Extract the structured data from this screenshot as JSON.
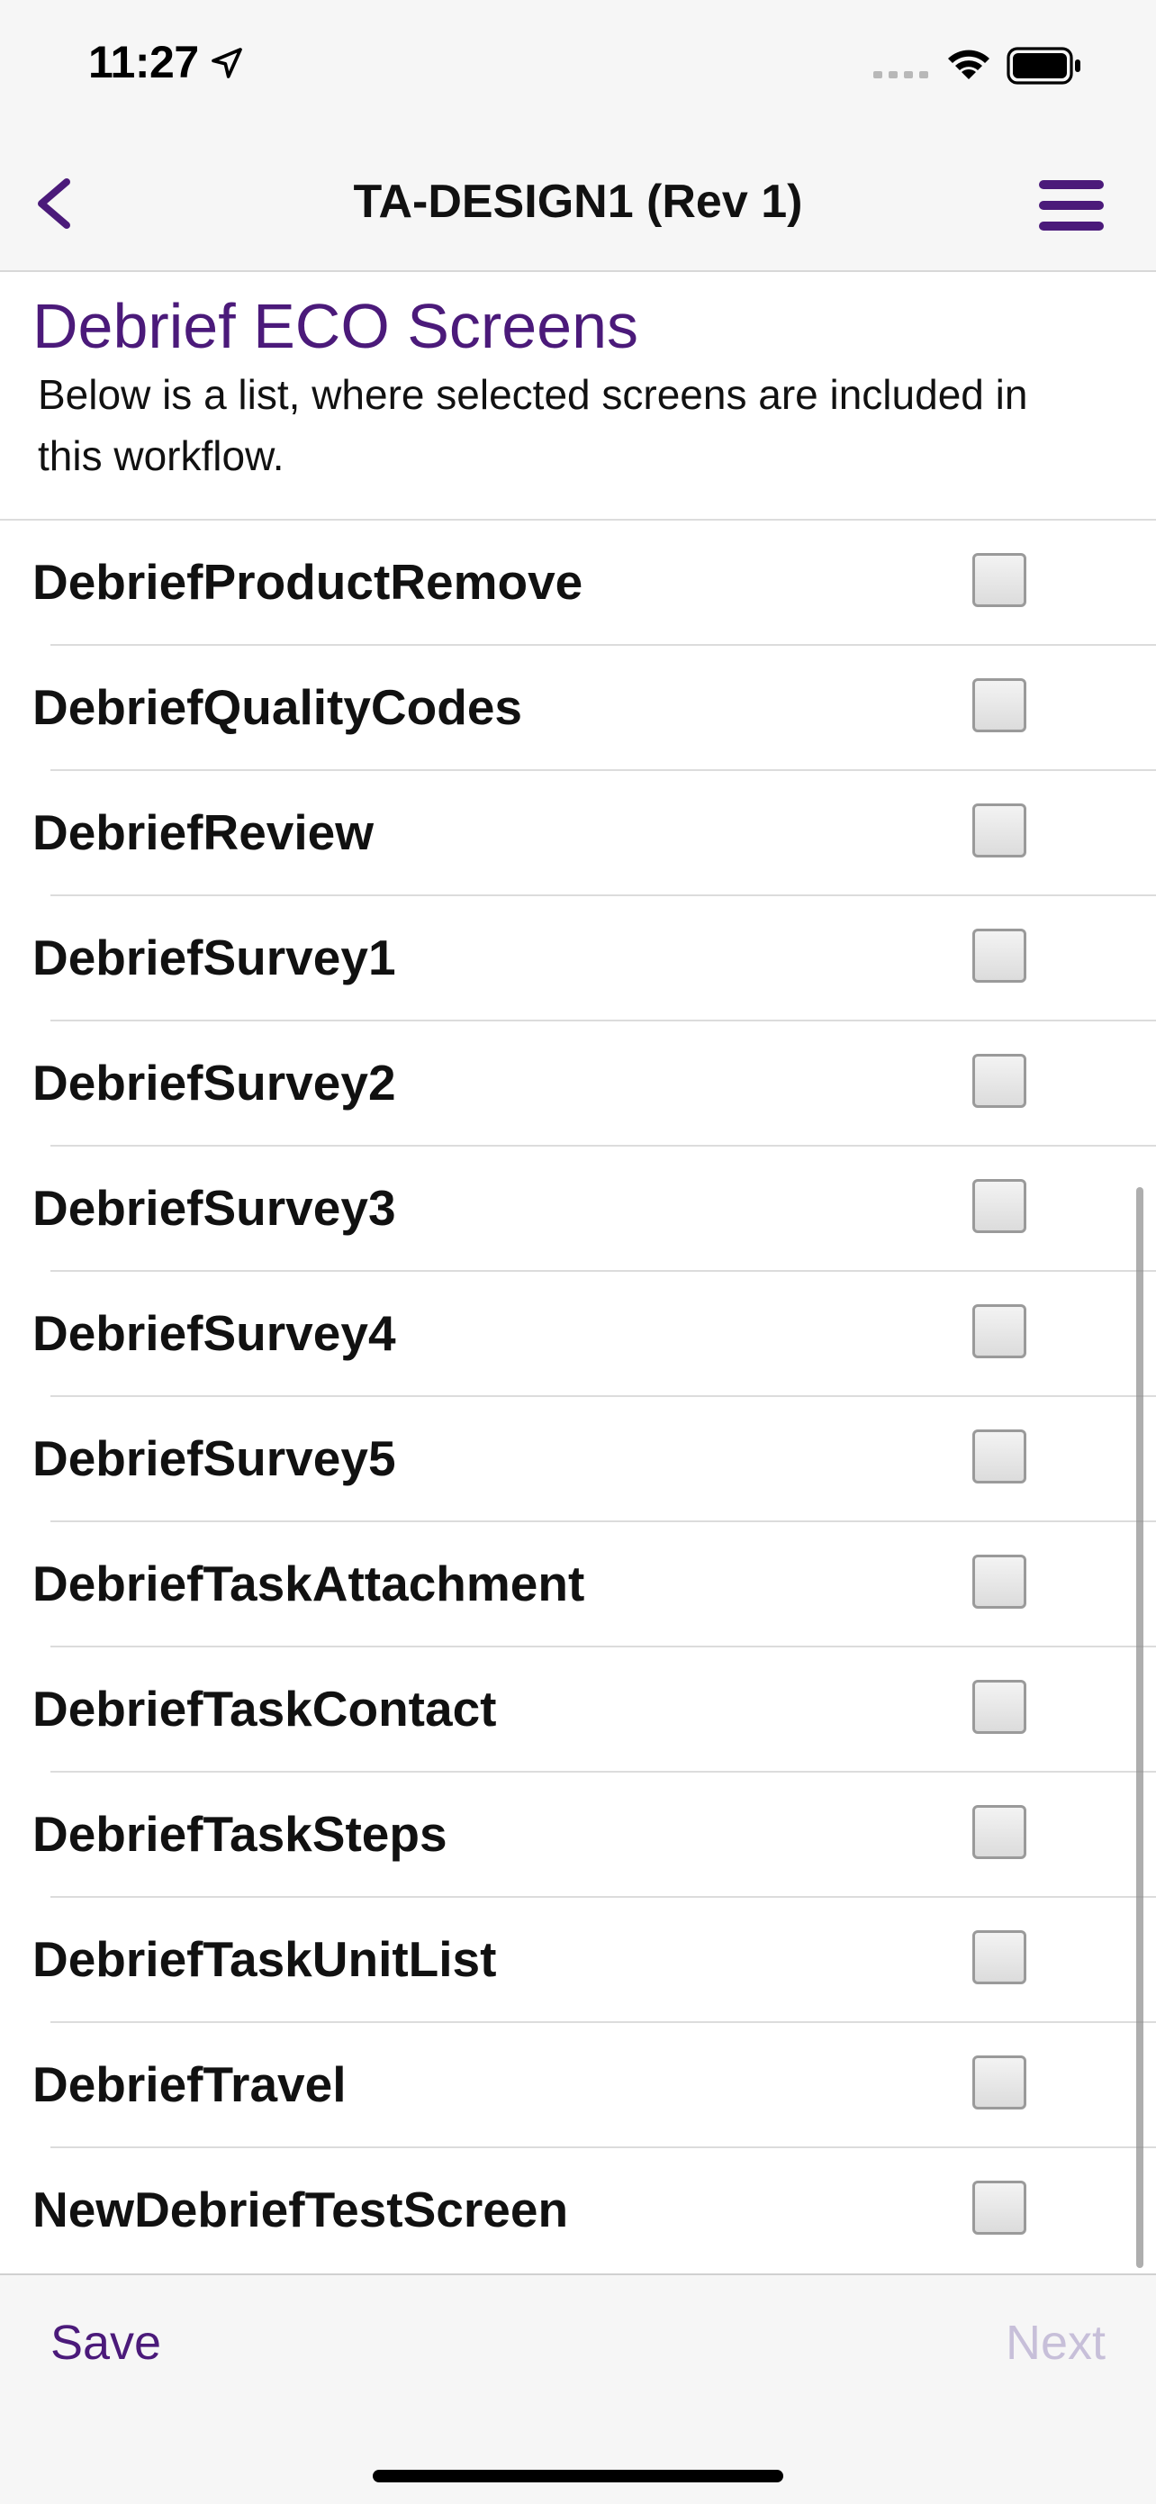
{
  "status_bar": {
    "time": "11:27"
  },
  "nav": {
    "title": "TA-DESIGN1 (Rev 1)",
    "back_icon": "chevron-left-icon",
    "menu_icon": "hamburger-menu-icon"
  },
  "section": {
    "title": "Debrief ECO Screens",
    "description": "Below is a list, where selected screens are included in this workflow."
  },
  "items": [
    {
      "label": "DebriefProductRemove",
      "checked": false
    },
    {
      "label": "DebriefQualityCodes",
      "checked": false
    },
    {
      "label": "DebriefReview",
      "checked": false
    },
    {
      "label": "DebriefSurvey1",
      "checked": false
    },
    {
      "label": "DebriefSurvey2",
      "checked": false
    },
    {
      "label": "DebriefSurvey3",
      "checked": false
    },
    {
      "label": "DebriefSurvey4",
      "checked": false
    },
    {
      "label": "DebriefSurvey5",
      "checked": false
    },
    {
      "label": "DebriefTaskAttachment",
      "checked": false
    },
    {
      "label": "DebriefTaskContact",
      "checked": false
    },
    {
      "label": "DebriefTaskSteps",
      "checked": false
    },
    {
      "label": "DebriefTaskUnitList",
      "checked": false
    },
    {
      "label": "DebriefTravel",
      "checked": false
    },
    {
      "label": "NewDebriefTestScreen",
      "checked": false
    }
  ],
  "toolbar": {
    "save_label": "Save",
    "next_label": "Next",
    "next_enabled": false
  },
  "colors": {
    "accent": "#4b1a7a",
    "disabled": "#c7bfd9"
  }
}
